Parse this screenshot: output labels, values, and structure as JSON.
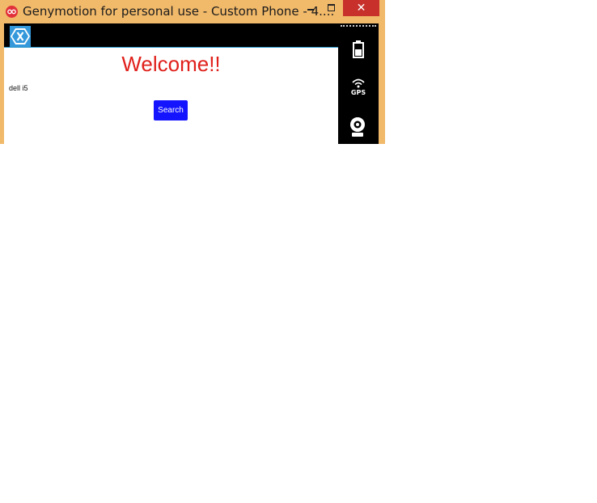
{
  "window": {
    "title": "Genymotion for personal use - Custom Phone - 4....",
    "close_glyph": "✕"
  },
  "app": {
    "heading": "Welcome!!",
    "entry_text": "dell i5",
    "search_button": "Search"
  },
  "sidebar": {
    "gps_label": "GPS",
    "icons": [
      "battery-icon",
      "gps-icon",
      "webcam-icon"
    ]
  },
  "colors": {
    "titlebar": "#f1b96a",
    "close": "#c7302b",
    "heading": "#e0201b",
    "button": "#1414ff",
    "actionbar_accent": "#2a95c9",
    "xamarin_blue": "#3498db"
  }
}
